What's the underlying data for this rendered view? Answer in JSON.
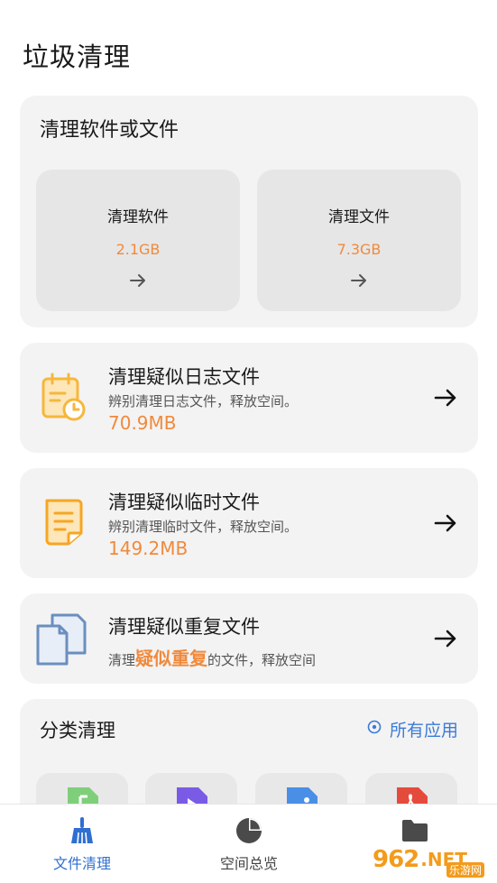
{
  "page": {
    "title": "垃圾清理"
  },
  "soft_or_file": {
    "title": "清理软件或文件",
    "tiles": [
      {
        "label": "清理软件",
        "size": "2.1GB"
      },
      {
        "label": "清理文件",
        "size": "7.3GB"
      }
    ]
  },
  "log_card": {
    "title": "清理疑似日志文件",
    "desc": "辨别清理日志文件，释放空间。",
    "size": "70.9MB"
  },
  "temp_card": {
    "title": "清理疑似临时文件",
    "desc": "辨别清理临时文件，释放空间。",
    "size": "149.2MB"
  },
  "dup_card": {
    "title": "清理疑似重复文件",
    "desc_prefix": "清理",
    "desc_highlight": "疑似重复",
    "desc_suffix": "的文件，释放空间"
  },
  "category": {
    "title": "分类清理",
    "all_apps": "所有应用"
  },
  "nav": {
    "items": [
      {
        "label": "文件清理",
        "active": true
      },
      {
        "label": "空间总览",
        "active": false
      },
      {
        "label": "",
        "active": false
      }
    ]
  },
  "watermark": {
    "num": "962",
    "net": ".NET",
    "sub": "乐游网"
  },
  "colors": {
    "accent": "#f08a3c",
    "blue": "#3b7bd8",
    "card_bg": "#f3f3f3"
  }
}
